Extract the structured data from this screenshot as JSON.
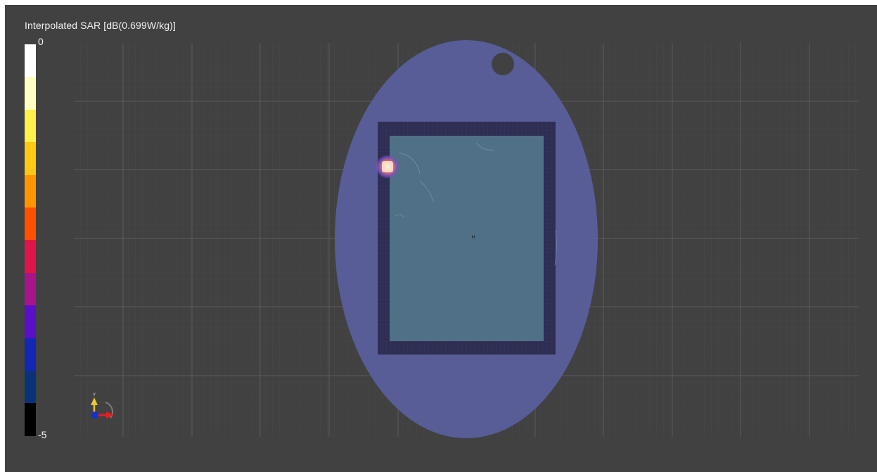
{
  "viewer": {
    "title": "Interpolated SAR [dB(0.699W/kg)]",
    "background_color": "#414141"
  },
  "colorbar": {
    "max_label": "0",
    "min_label": "-5",
    "colors": [
      "#ffffff",
      "#ffffc2",
      "#fff04a",
      "#ffc814",
      "#ff9600",
      "#ff5000",
      "#e01446",
      "#a8148c",
      "#5a10c8",
      "#1028b4",
      "#0a3278",
      "#000000"
    ]
  },
  "phantom": {
    "fill_color": "#5a5f9e",
    "device_frame_color": "#2e2d52",
    "device_screen_color": "#4f7086"
  },
  "hotspot": {
    "core_color": "#ffe6c8",
    "mid_color": "#e8785a",
    "outer_color": "#7a4ec8"
  },
  "axis_triad": {
    "y_label": "Y",
    "y_color": "#e8c832",
    "x_color": "#e02020",
    "z_color": "#1830c8"
  },
  "center_marker": "H"
}
